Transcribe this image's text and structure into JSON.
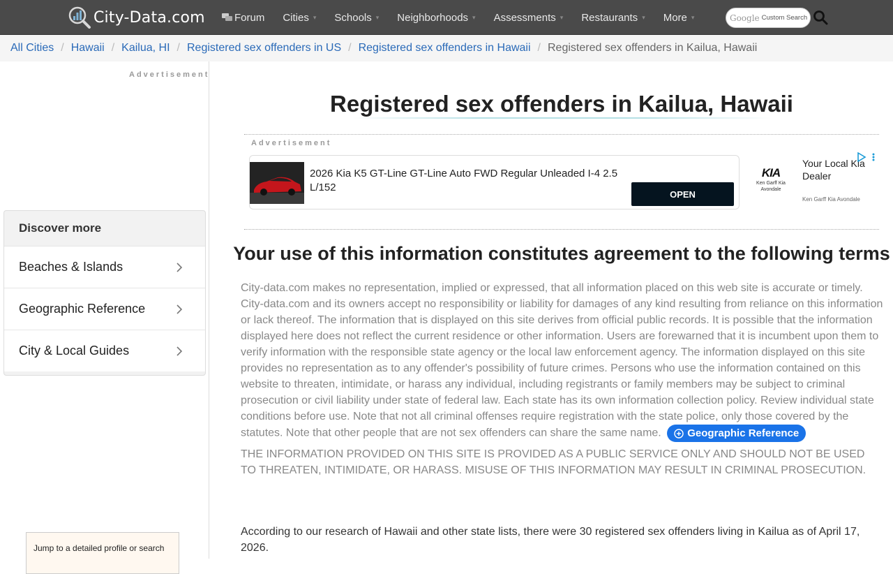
{
  "header": {
    "logo_text": "City-Data.com",
    "nav": [
      {
        "label": "Forum",
        "icon": "forum-icon",
        "caret": false
      },
      {
        "label": "Cities",
        "caret": true
      },
      {
        "label": "Schools",
        "caret": true
      },
      {
        "label": "Neighborhoods",
        "caret": true
      },
      {
        "label": "Assessments",
        "caret": true
      },
      {
        "label": "Restaurants",
        "caret": true
      },
      {
        "label": "More",
        "caret": true
      }
    ],
    "search_brand": "Google",
    "search_placeholder": "Custom Search"
  },
  "breadcrumb": {
    "items": [
      "All Cities",
      "Hawaii",
      "Kailua, HI",
      "Registered sex offenders in US",
      "Registered sex offenders in Hawaii"
    ],
    "current": "Registered sex offenders in Kailua, Hawaii"
  },
  "sidebar": {
    "ad_label": "Advertisement",
    "discover_title": "Discover more",
    "discover_items": [
      "Beaches & Islands",
      "Geographic Reference",
      "City & Local Guides"
    ],
    "jump_text": "Jump to a detailed profile or search"
  },
  "main": {
    "title": "Registered sex offenders in Kailua, Hawaii",
    "ad_label": "Advertisement",
    "ad": {
      "headline": "2026 Kia K5 GT-Line GT-Line Auto FWD Regular Unleaded I-4 2.5 L/152",
      "button": "OPEN",
      "brand_mark": "KIA",
      "brand_small": "Ken Garff Kia Avondale",
      "dealer": "Your Local Kia Dealer",
      "dealer_sub": "Ken Garff Kia Avondale"
    },
    "terms_title": "Your use of this information constitutes agreement to the following terms",
    "terms_body": "City-data.com makes no representation, implied or expressed, that all information placed on this web site is accurate or timely. City-data.com and its owners accept no responsibility or liability for damages of any kind resulting from reliance on this information or lack thereof. The information that is displayed on this site derives from official public records. It is possible that the information displayed here does not reflect the current residence or other information. Users are forewarned that it is incumbent upon them to verify information with the responsible state agency or the local law enforcement agency. The information displayed on this site provides no representation as to any offender's possibility of future crimes. Persons who use the information contained on this website to threaten, intimidate, or harass any individual, including registrants or family members may be subject to criminal prosecution or civil liability under state of federal law. Each state has its own information collection policy. Review individual state conditions before use. Note that not all criminal offenses require registration with the state police, only those covered by the statutes. Note that other people that are not sex offenders can share the same name.",
    "geo_button": "Geographic Reference",
    "warning": "THE INFORMATION PROVIDED ON THIS SITE IS PROVIDED AS A PUBLIC SERVICE ONLY AND SHOULD NOT BE USED TO THREATEN, INTIMIDATE, OR HARASS. MISUSE OF THIS INFORMATION MAY RESULT IN CRIMINAL PROSECUTION.",
    "research": "According to our research of Hawaii and other state lists, there were 30 registered sex offenders living in Kailua as of April 17, 2026."
  },
  "colors": {
    "topbar": "#4a4a4a",
    "link": "#2a6ab8",
    "button_blue": "#1a73e8",
    "ad_button": "#05141f"
  }
}
